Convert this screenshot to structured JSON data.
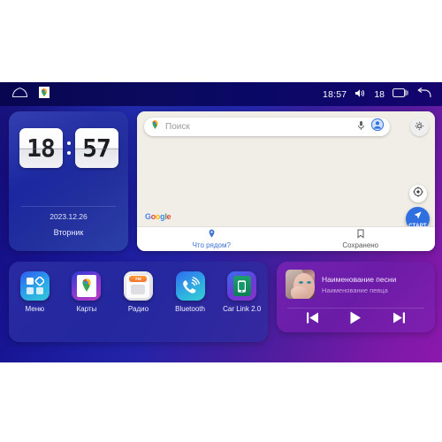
{
  "statusbar": {
    "home_icon": "home-icon",
    "maps_app_icon": "google-maps-app-icon",
    "time": "18:57",
    "volume_icon": "volume-icon",
    "volume_level": "18",
    "recents_icon": "recents-icon",
    "back_icon": "back-arrow-icon"
  },
  "clock_widget": {
    "hours": "18",
    "minutes": "57",
    "date": "2023.12.26",
    "weekday": "Вторник"
  },
  "map_widget": {
    "search_placeholder": "Поиск",
    "search_value": "",
    "pin_icon": "maps-pin-icon",
    "mic_icon": "microphone-icon",
    "account_icon": "account-avatar-icon",
    "settings_icon": "gear-icon",
    "google_logo": "Google",
    "locate_icon": "locate-compass-icon",
    "start_label": "СТАРТ",
    "tabs": [
      {
        "label": "Что рядом?",
        "icon": "location-pin-icon",
        "active": true
      },
      {
        "label": "Сохранено",
        "icon": "bookmark-icon",
        "active": false
      }
    ]
  },
  "dock": {
    "apps": [
      {
        "label": "Меню",
        "icon": "apps-grid-icon"
      },
      {
        "label": "Карты",
        "icon": "google-maps-icon"
      },
      {
        "label": "Радио",
        "icon": "radio-icon",
        "band": "FM"
      },
      {
        "label": "Bluetooth",
        "icon": "bluetooth-phone-icon"
      },
      {
        "label": "Car Link 2.0",
        "icon": "car-link-icon"
      }
    ]
  },
  "media_widget": {
    "album_art": "album-art-woman-portrait",
    "title": "Наименование песни",
    "artist": "Наименование певца",
    "controls": [
      {
        "name": "previous-button",
        "icon": "skip-previous-icon"
      },
      {
        "name": "play-button",
        "icon": "play-icon"
      },
      {
        "name": "next-button",
        "icon": "skip-next-icon"
      }
    ]
  },
  "colors": {
    "bg_start": "#140a6e",
    "bg_end": "#8d18ad",
    "accent_blue": "#2f6fe0",
    "map_bg": "#f1eee7",
    "statusbar": "#0a0866"
  }
}
